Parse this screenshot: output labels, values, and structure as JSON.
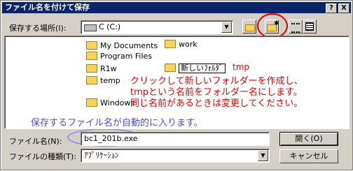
{
  "window": {
    "title": "ファイル名を付けて保存",
    "help_btn": "?",
    "close_btn": "X"
  },
  "location": {
    "label": "保存する場所(I):",
    "value": "C (C:)"
  },
  "files": [
    {
      "name": "My Documents"
    },
    {
      "name": "Program Files"
    },
    {
      "name": "R1w"
    },
    {
      "name": "temp"
    },
    {
      "name": "Windows"
    },
    {
      "name": "work"
    }
  ],
  "new_folder": {
    "value": "新しいﾌｫﾙﾀﾞ",
    "typed": "tmp"
  },
  "annotations": {
    "instruction": [
      "クリックして新しいフォルダーを作成し、",
      "tmpという名前をフォルダー名にします。",
      "同じ名前があるときは変更してください。"
    ],
    "auto_filename": "保存するファイル名が自動的に入ります。"
  },
  "filename": {
    "label": "ファイル名(N):",
    "value": "bc1_201b.exe"
  },
  "filetype": {
    "label": "ファイルの種類(T):",
    "value": "ｱﾌﾟﾘｹｰｼｮﾝ"
  },
  "buttons": {
    "open": "開く(O)",
    "cancel": "キャンセル"
  },
  "colors": {
    "annotation_red": "#e00000",
    "annotation_blue": "#4a4ae0",
    "titlebar": "#0a246a"
  }
}
